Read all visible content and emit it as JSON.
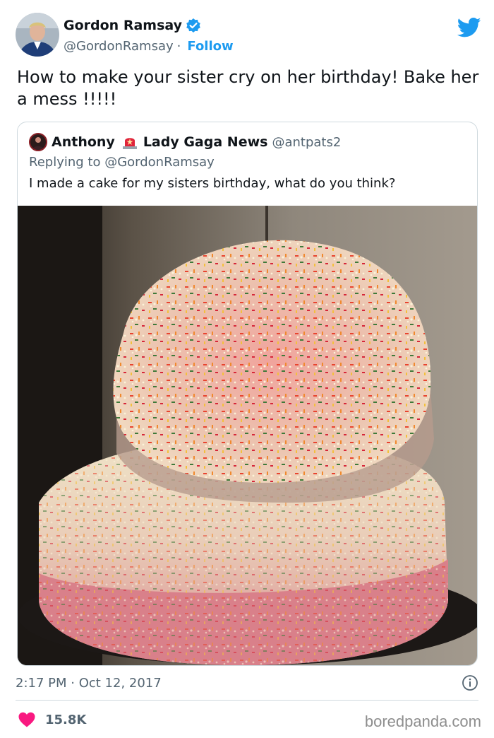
{
  "author": {
    "display_name": "Gordon Ramsay",
    "handle": "@GordonRamsay",
    "separator": "·",
    "follow_label": "Follow",
    "verified": true,
    "avatar_icon": "person-photo-avatar"
  },
  "brand_icon": "twitter-bird-icon",
  "tweet": {
    "text": "How to make your sister cry on her birthday! Bake her a mess !!!!!"
  },
  "quoted_tweet": {
    "display_name_part1": "Anthony",
    "display_name_part2": "Lady Gaga News",
    "emoji_icon": "police-siren-icon",
    "handle": "@antpats2",
    "reply_to": "Replying to @GordonRamsay",
    "text": "I made a cake for my sisters birthday, what do you think?",
    "photo_icon": "messy-birthday-cake-photo"
  },
  "meta": {
    "timestamp": "2:17 PM · Oct 12, 2017",
    "info_icon": "info-icon"
  },
  "engagement": {
    "like_count": "15.8K",
    "like_icon": "heart-icon"
  },
  "watermark": "boredpanda.com",
  "colors": {
    "accent": "#1d9bf0",
    "heart": "#f91880",
    "secondary_text": "#536471",
    "border": "#cfd9de"
  }
}
